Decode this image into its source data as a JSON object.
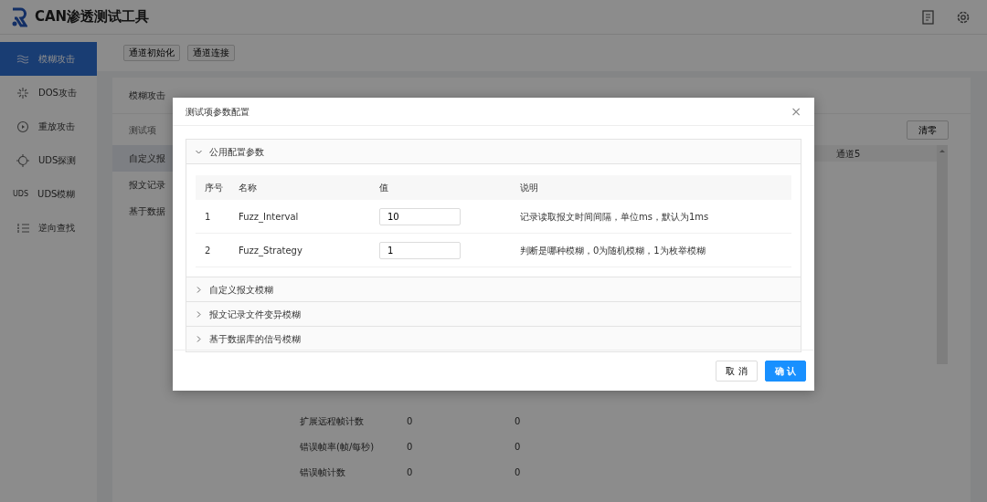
{
  "app": {
    "title": "CAN渗透测试工具"
  },
  "sidebar": {
    "items": [
      {
        "label": "模糊攻击",
        "selected": true
      },
      {
        "label": "DOS攻击",
        "selected": false
      },
      {
        "label": "重放攻击",
        "selected": false
      },
      {
        "label": "UDS探测",
        "selected": false
      },
      {
        "label": "UDS模糊",
        "icon_text": "UDS",
        "selected": false
      },
      {
        "label": "逆向查找",
        "selected": false
      }
    ]
  },
  "toolbar": {
    "buttons": [
      "通道初始化",
      "通道连接"
    ]
  },
  "panel": {
    "title": "模糊攻击",
    "test_items": {
      "header": "测试项",
      "items": [
        {
          "label": "自定义报",
          "selected": true
        },
        {
          "label": "报文记录",
          "selected": false
        },
        {
          "label": "基于数据",
          "selected": false
        }
      ]
    },
    "clear_button": "清零",
    "channel_header": "通道5",
    "stats": [
      {
        "label": "扩展远程帧计数",
        "values": [
          "0",
          "0"
        ]
      },
      {
        "label": "错误帧率(帧/每秒)",
        "values": [
          "0",
          "0"
        ]
      },
      {
        "label": "错误帧计数",
        "values": [
          "0",
          "0"
        ]
      }
    ]
  },
  "modal": {
    "title": "测试项参数配置",
    "close": "×",
    "sections": [
      {
        "title": "公用配置参数",
        "expanded": true,
        "table": {
          "columns": [
            "序号",
            "名称",
            "值",
            "说明"
          ],
          "rows": [
            {
              "index": "1",
              "name": "Fuzz_Interval",
              "value": "10",
              "description": "记录读取报文时间间隔，单位ms，默认为1ms"
            },
            {
              "index": "2",
              "name": "Fuzz_Strategy",
              "value": "1",
              "description": "判断是哪种模糊，0为随机模糊，1为枚举模糊"
            }
          ]
        }
      },
      {
        "title": "自定义报文模糊",
        "expanded": false
      },
      {
        "title": "报文记录文件变异模糊",
        "expanded": false
      },
      {
        "title": "基于数据库的信号模糊",
        "expanded": false
      }
    ],
    "buttons": [
      {
        "label": "取 消",
        "kind": "default"
      },
      {
        "label": "确 认",
        "kind": "primary"
      }
    ]
  }
}
